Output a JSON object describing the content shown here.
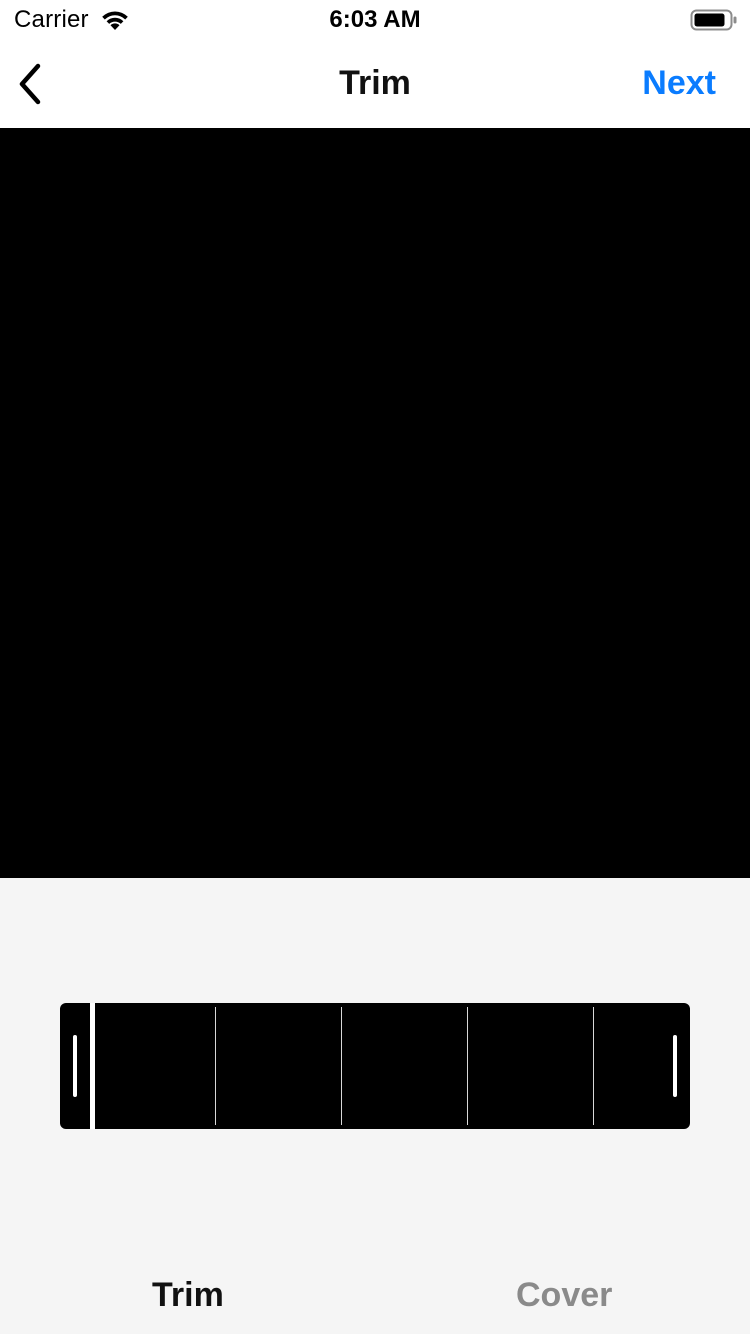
{
  "status_bar": {
    "carrier": "Carrier",
    "time": "6:03 AM",
    "wifi_icon": "wifi-icon",
    "battery_icon": "battery-icon"
  },
  "nav": {
    "back_icon": "chevron-left-icon",
    "title": "Trim",
    "next_label": "Next",
    "next_color": "#0a7cff"
  },
  "video": {
    "background": "#000000"
  },
  "trimmer": {
    "start_handle": "trim-start-handle",
    "end_handle": "trim-end-handle",
    "frame_count": 5
  },
  "tabs": {
    "items": [
      {
        "label": "Trim",
        "selected": true
      },
      {
        "label": "Cover",
        "selected": false
      }
    ]
  }
}
